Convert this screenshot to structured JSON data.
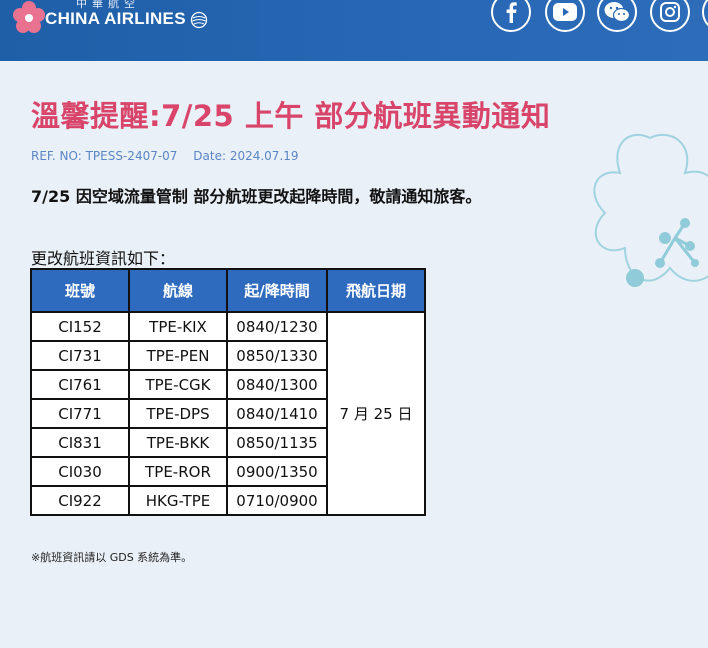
{
  "header": {
    "logo_chinese": "中華航空",
    "logo_text": "CHINA AIRLINES",
    "social": [
      {
        "icon": "facebook-icon"
      },
      {
        "icon": "youtube-icon"
      },
      {
        "icon": "wechat-icon"
      },
      {
        "icon": "instagram-icon"
      },
      {
        "icon": "more-social-icon"
      }
    ]
  },
  "notice": {
    "title": "溫馨提醒:7/25 上午 部分航班異動通知",
    "ref_no": "REF. NO: TPESS-2407-07",
    "date": "Date: 2024.07.19",
    "lead": "7/25 因空域流量管制 部分航班更改起降時間，敬請通知旅客。",
    "table_intro": "更改航班資訊如下：",
    "footnote": "※航班資訊請以 GDS 系統為準。"
  },
  "table": {
    "headers": [
      "班號",
      "航線",
      "起/降時間",
      "飛航日期"
    ],
    "rows": [
      {
        "flight": "CI152",
        "route": "TPE-KIX",
        "time": "0840/1230"
      },
      {
        "flight": "CI731",
        "route": "TPE-PEN",
        "time": "0850/1330"
      },
      {
        "flight": "CI761",
        "route": "TPE-CGK",
        "time": "0840/1300"
      },
      {
        "flight": "CI771",
        "route": "TPE-DPS",
        "time": "0840/1410"
      },
      {
        "flight": "CI831",
        "route": "TPE-BKK",
        "time": "0850/1135"
      },
      {
        "flight": "CI030",
        "route": "TPE-ROR",
        "time": "0900/1350"
      },
      {
        "flight": "CI922",
        "route": "HKG-TPE",
        "time": "0710/0900"
      }
    ],
    "date_cell": "7 月 25 日"
  },
  "colors": {
    "title": "#d9456a",
    "header_bg": "#2767b4",
    "table_header": "#2e6bbf",
    "ref_text": "#5a86c5",
    "page_bg": "#eaf0f7"
  }
}
